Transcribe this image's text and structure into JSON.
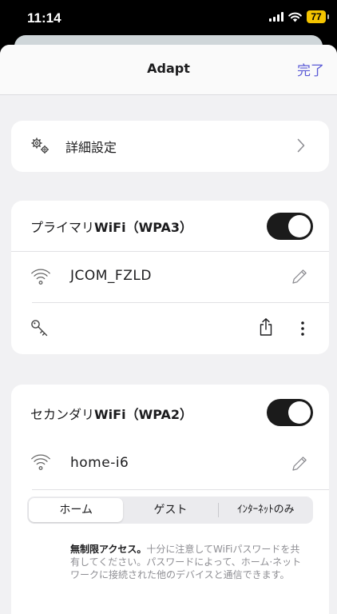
{
  "status_bar": {
    "time": "11:14",
    "battery": "77"
  },
  "nav": {
    "title": "Adapt",
    "done_label": "完了"
  },
  "advanced": {
    "label": "詳細設定",
    "icon": "gears-icon"
  },
  "primary": {
    "title_ja": "プライマリ",
    "title_wifi": "WiFi",
    "title_sec": "（WPA3）",
    "enabled": true,
    "ssid": "JCOM_FZLD"
  },
  "secondary": {
    "title_ja": "セカンダリ",
    "title_wifi": "WiFi",
    "title_sec": "（WPA2）",
    "enabled": true,
    "ssid": "home-i6",
    "segments": [
      "ホーム",
      "ゲスト",
      "ｲﾝﾀｰﾈｯﾄのみ"
    ],
    "selected_segment": "ホーム",
    "desc_bold": "無制限アクセス。",
    "desc_text": "十分に注意してWiFiパスワードを共有してください。パスワードによって、ホーム·ネットワークに接続された他のデバイスと通信できます。"
  },
  "colors": {
    "accent": "#5b5bd6",
    "toggle_on": "#1b1b1b",
    "battery": "#f4c400"
  }
}
